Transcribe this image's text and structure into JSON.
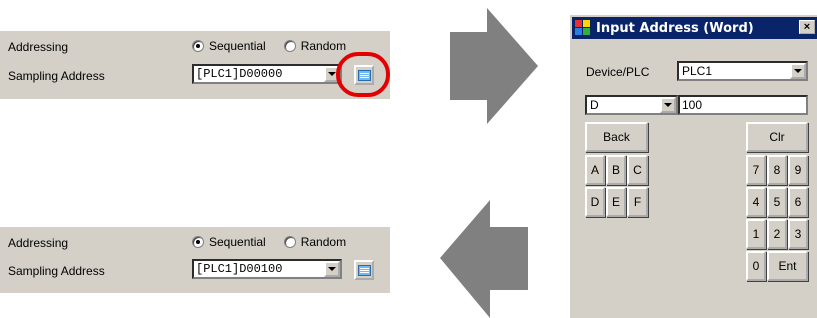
{
  "top_panel": {
    "addressing_label": "Addressing",
    "radio_sequential": "Sequential",
    "radio_random": "Random",
    "sampling_label": "Sampling Address",
    "address_value": "[PLC1]D00000"
  },
  "bottom_panel": {
    "addressing_label": "Addressing",
    "radio_sequential": "Sequential",
    "radio_random": "Random",
    "sampling_label": "Sampling Address",
    "address_value": "[PLC1]D00100"
  },
  "dialog": {
    "title": "Input Address (Word)",
    "close_label": "×",
    "device_label": "Device/PLC",
    "device_value": "PLC1",
    "device_type_value": "D",
    "address_input_value": "100",
    "keys": {
      "back": "Back",
      "clr": "Clr",
      "a": "A",
      "b": "B",
      "c": "C",
      "d": "D",
      "e": "E",
      "f": "F",
      "n7": "7",
      "n8": "8",
      "n9": "9",
      "n4": "4",
      "n5": "5",
      "n6": "6",
      "n1": "1",
      "n2": "2",
      "n3": "3",
      "n0": "0",
      "ent": "Ent"
    }
  },
  "colors": {
    "panel_bg": "#d4d0c8",
    "titlebar": "#0a246a",
    "highlight": "#e30000",
    "arrow": "#808080"
  }
}
